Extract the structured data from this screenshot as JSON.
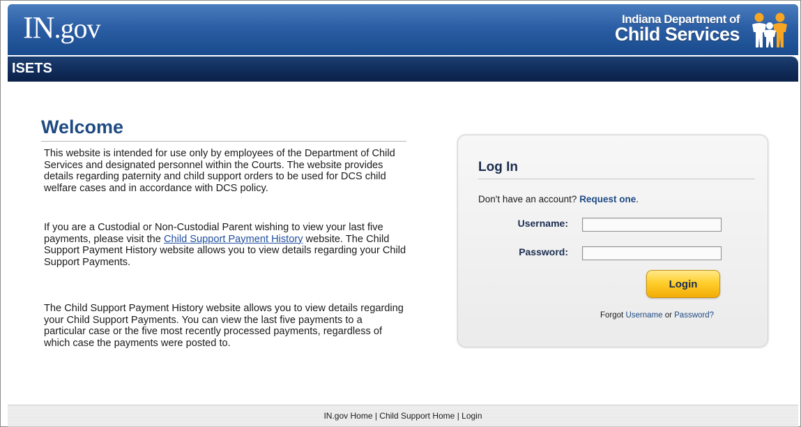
{
  "header": {
    "logo_main": "IN",
    "logo_suffix": ".gov",
    "agency_line1": "Indiana Department of",
    "agency_line2": "Child Services",
    "app_name": "ISETS"
  },
  "welcome": {
    "title": "Welcome",
    "p1": "This website is intended for use only by employees of the Department of Child Services and designated personnel within the Courts. The website provides details regarding paternity and child support orders to be used for DCS child welfare cases and in accordance with DCS policy.",
    "p2_before": "If you are a Custodial or Non-Custodial Parent wishing to view your last five payments, please visit the ",
    "p2_link": "Child Support Payment History",
    "p2_after": " website. The Child Support Payment History website allows you to view details regarding your Child Support Payments.",
    "p3": "The Child Support Payment History website allows you to view details regarding your Child Support Payments. You can view the last five payments to a particular case or the five most recently processed payments, regardless of which case the payments were posted to."
  },
  "login": {
    "title": "Log In",
    "no_account_text": "Don't have an account? ",
    "request_link": "Request one",
    "request_suffix": ".",
    "username_label": "Username:",
    "username_value": "",
    "password_label": "Password:",
    "password_value": "",
    "button_label": "Login",
    "forgot_prefix": "Forgot ",
    "forgot_username": "Username",
    "forgot_or": " or ",
    "forgot_password": "Password?"
  },
  "footer": {
    "links": [
      "IN.gov Home",
      "Child Support Home",
      "Login"
    ],
    "separator": " | "
  },
  "colors": {
    "header_blue": "#2b5ea4",
    "subbar_navy": "#0f2b58",
    "title_blue": "#1e4a82",
    "button_gold": "#ffcf2e"
  }
}
